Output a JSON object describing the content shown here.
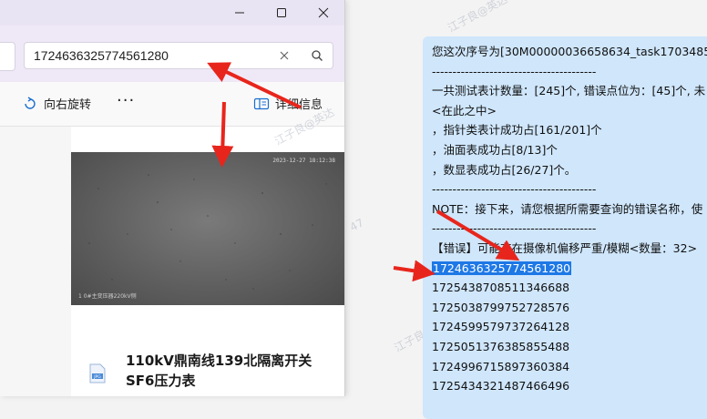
{
  "window": {
    "controls": [
      "minimize",
      "maximize",
      "close"
    ]
  },
  "search": {
    "value": "1724636325774561280"
  },
  "toolbar": {
    "rotate_label": "向右旋转",
    "more_label": "···",
    "details_label": "详细信息"
  },
  "preview": {
    "photo_timestamp": "2023-12-27 18:12:38",
    "photo_caption": "1 0#主变压器220kV侧",
    "file_name": "110kV鼎南线139北隔离开关SF6压力表",
    "file_icon_text": "JPG"
  },
  "chat": {
    "lines": [
      "您这次序号为[30M00000036658634_task1703485",
      "----------------------------------------",
      "一共测试表计数量：[245]个, 错误点位为：[45]个, 未",
      "<在此之中>",
      "，指针类表计成功占[161/201]个",
      "，油面表成功占[8/13]个",
      "，数显表成功占[26/27]个。",
      "----------------------------------------",
      "NOTE：接下来，请您根据所需要查询的错误名称，使",
      "----------------------------------------",
      "【错误】可能存在摄像机偏移严重/模糊<数量：32>",
      "1724636325774561280",
      "1725438708511346688",
      "1725038799752728576",
      "1724599579737264128",
      "1725051376385855488",
      "1724996715897360384",
      "1725434321487466496"
    ]
  },
  "watermarks": {
    "text_a": "江子良@英达",
    "text_b": "江子良@英达",
    "text_c": "江子良@英",
    "text_d": "47"
  },
  "colors": {
    "arrow": "#e8251c",
    "highlight": "#1e78e6",
    "bubble": "#cfe6fb"
  }
}
